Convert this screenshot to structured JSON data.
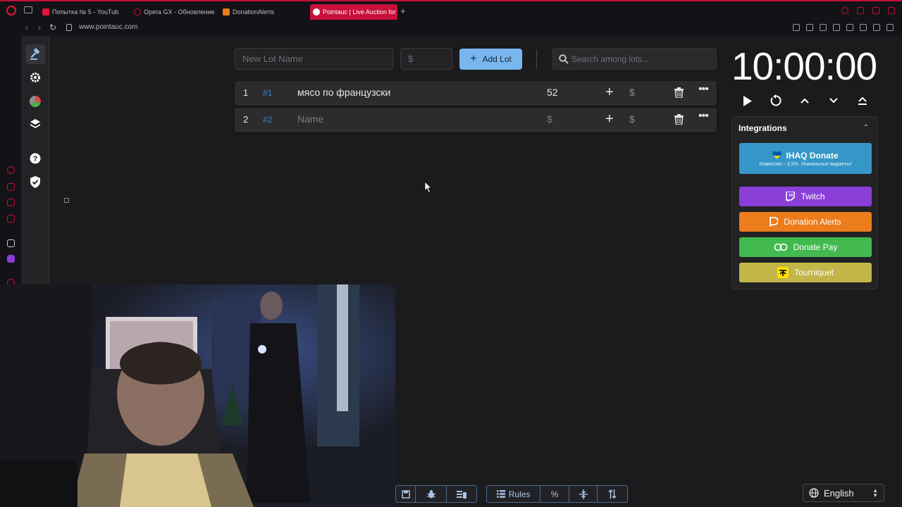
{
  "browser": {
    "tabs": [
      {
        "label": "Попытка № 5 - YouTub",
        "favicon_color": "#e0163c"
      },
      {
        "label": "Opera GX - Обновление",
        "favicon_color": "#c0103b"
      },
      {
        "label": "DonationAlerts",
        "favicon_color": "#ec7c1c"
      },
      {
        "label": "Pointauc | Live Auction for",
        "favicon_color": "#ffffff"
      }
    ],
    "url": "www.pointauc.com"
  },
  "sidebar": {
    "items": [
      "auction-icon",
      "settings-icon",
      "stats-icon",
      "layers-icon",
      "help-icon",
      "shield-icon"
    ]
  },
  "lot_form": {
    "name_placeholder": "New Lot Name",
    "price_placeholder": "$",
    "add_label": "Add Lot"
  },
  "search": {
    "placeholder": "Search among lots..."
  },
  "lots": [
    {
      "index": "1",
      "fast_id": "#1",
      "name": "мясо по французски",
      "amount": "52",
      "add": "+",
      "dollar": "$"
    },
    {
      "index": "2",
      "fast_id": "#2",
      "name": "Name",
      "amount": "$",
      "add": "+",
      "dollar": "$"
    }
  ],
  "timer": {
    "display": "10:00:00"
  },
  "integrations": {
    "title": "Integrations",
    "ihaq": {
      "label": "IHAQ Donate",
      "subtitle": "Комиссия – 3,5%. Уникальные виджеты!"
    },
    "twitch": {
      "label": "Twitch"
    },
    "donation_alerts": {
      "label": "Donation Alerts"
    },
    "donate_pay": {
      "label": "Donate Pay"
    },
    "tourniquet": {
      "label": "Tourniquet"
    }
  },
  "toolbar": {
    "rules_label": "Rules",
    "percent_label": "%"
  },
  "language": {
    "selected": "English"
  },
  "colors": {
    "accent": "#79b6ee",
    "twitch": "#8b3fd9",
    "donation_alerts": "#ec7c1c",
    "donate_pay": "#43ba4f",
    "tourniquet": "#c2b648",
    "ihaq": "#3597c7"
  }
}
